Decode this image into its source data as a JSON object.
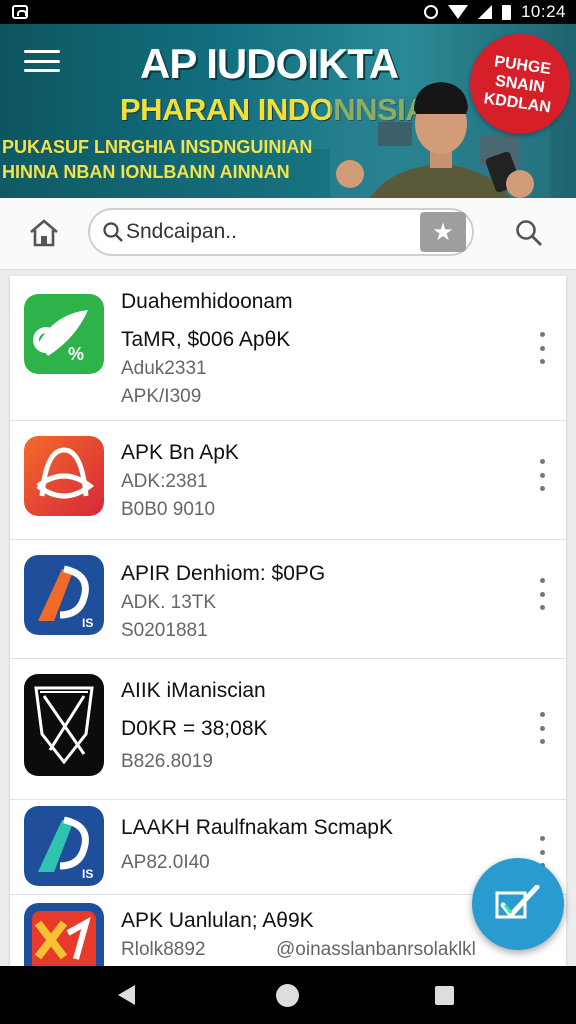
{
  "status_bar": {
    "time": "10:24"
  },
  "banner": {
    "title": "AP IUDOIKTA",
    "subtitle": "PHARAN INDONNSIA",
    "line1": "PUKASUF LNRGHIA INSDNGUINIAN",
    "line2": "HINNA NBAN IONLBANN AINNAN",
    "badge": [
      "PUHGE",
      "SNAIN",
      "KDDLAN"
    ]
  },
  "search": {
    "placeholder": "Sndcaipan.."
  },
  "apps": [
    {
      "title": "Duahemhidoonam",
      "lines": [
        "TaMR, $006 ApθK",
        "Aduk2331",
        "APK/I309"
      ],
      "icon": "green-leaf-icon",
      "color": "#2db34a"
    },
    {
      "title": "APK Bn ApK",
      "lines": [
        "ADK:2381",
        "B0B0 9010"
      ],
      "icon": "orange-loop-icon",
      "color": "#e94e2a"
    },
    {
      "title": "APIR Denhiom: $0PG",
      "lines": [
        "ADK. 13TK",
        "S0201881"
      ],
      "icon": "blue-a-icon",
      "color": "#1f4f9a"
    },
    {
      "title": "AIIK iManiscian",
      "lines": [
        "D0KR = 38;08K",
        "B826.8019"
      ],
      "icon": "black-shield-icon",
      "color": "#111111"
    },
    {
      "title": "LAAKH Raulfnakam ScmapK",
      "lines": [
        "AP82.0I40"
      ],
      "icon": "blue-a-icon",
      "color": "#1f4f9a"
    },
    {
      "title": "APK Uanlulan; Aθ9K",
      "lines": [
        "Rlolk8892"
      ],
      "extra": "@oinasslanbanrsolaklkl",
      "icon": "red-yellow-x-icon",
      "color": "#e83a2a"
    }
  ],
  "colors": {
    "banner": "#137080",
    "accent": "#2a9bd0",
    "badge": "#d71f2a"
  }
}
